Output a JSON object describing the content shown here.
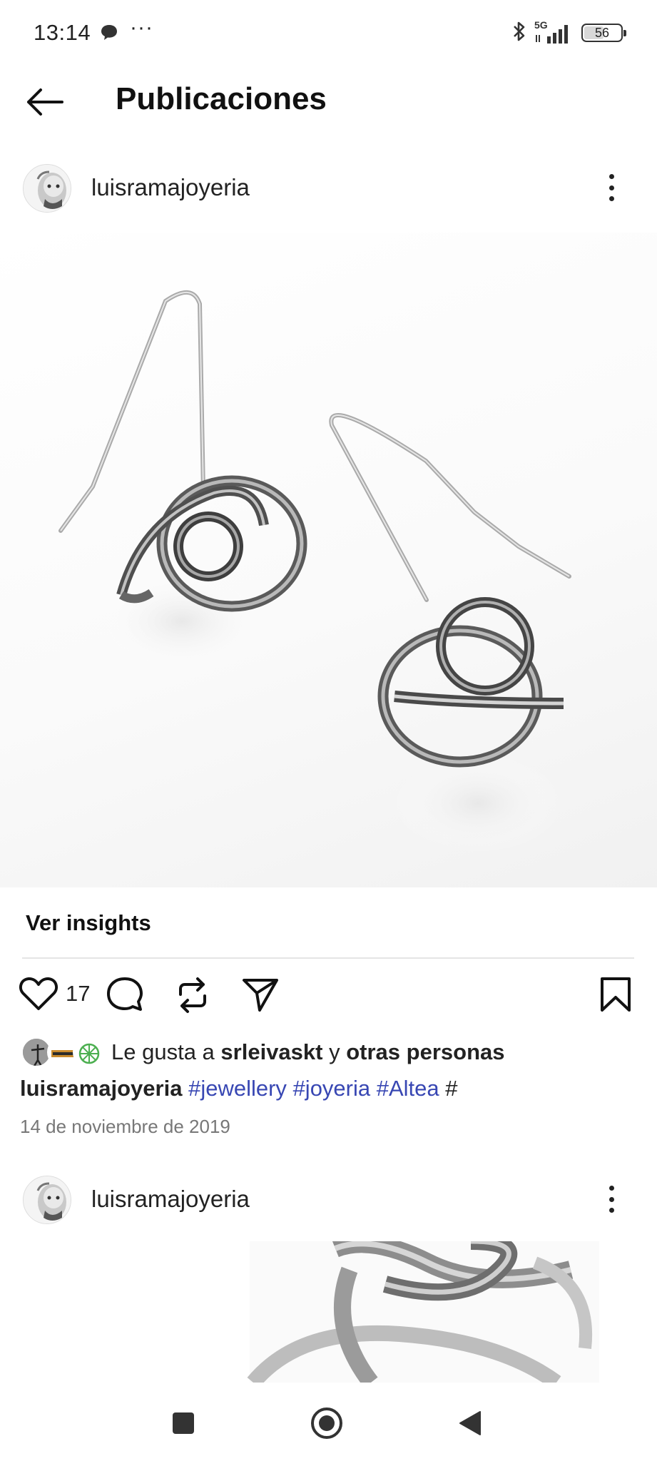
{
  "status_bar": {
    "time": "13:14",
    "more": "···",
    "network": "5G",
    "battery": "56",
    "battery_level_percent": 56,
    "icons": [
      "message-icon",
      "bluetooth-icon",
      "signal-icon",
      "battery-icon"
    ]
  },
  "header": {
    "title": "Publicaciones",
    "back_icon": "arrow-left-icon"
  },
  "post": {
    "username": "luisramajoyeria",
    "image_description_icon": "earrings-photo",
    "insights_label": "Ver insights",
    "like_count": "17",
    "likes": {
      "prefix": "Le gusta a",
      "user": "srleivaskt",
      "conjunction": "y",
      "others": "otras personas"
    },
    "caption": {
      "username": "luisramajoyeria",
      "hashtags": [
        "#jewellery",
        "#joyeria",
        "#Altea"
      ],
      "trailing": "#"
    },
    "date": "14 de noviembre de 2019",
    "action_icons": [
      "heart-icon",
      "comment-icon",
      "repost-icon",
      "share-icon",
      "bookmark-icon"
    ]
  },
  "next_post": {
    "username": "luisramajoyeria"
  },
  "nav": {
    "icons": [
      "recents-square-icon",
      "home-circle-icon",
      "back-triangle-icon"
    ]
  },
  "colors": {
    "hashtag": "#3847b3",
    "text": "#111111",
    "secondary": "#777777",
    "divider": "#e4e4e4"
  }
}
